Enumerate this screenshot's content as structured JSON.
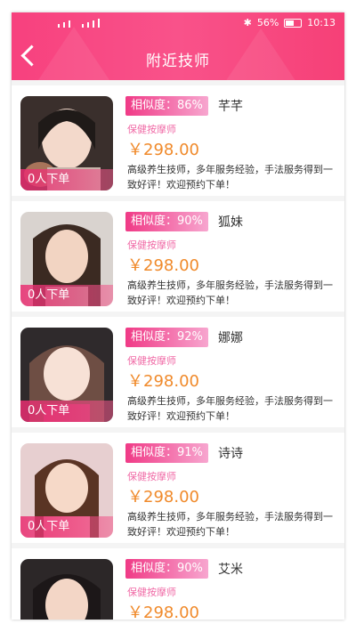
{
  "status_bar": {
    "battery_percent": "56%",
    "time": "10:13"
  },
  "header": {
    "title": "附近技师"
  },
  "technicians": [
    {
      "similarity": "相似度：86%",
      "name": "芊芊",
      "role": "保健按摩师",
      "price": "￥298.00",
      "desc": "高级养生技师，多年服务经验，手法服务得到一致好评！欢迎预约下单！",
      "orders": "0人下单"
    },
    {
      "similarity": "相似度：90%",
      "name": "狐妹",
      "role": "保健按摩师",
      "price": "￥298.00",
      "desc": "高级养生技师，多年服务经验，手法服务得到一致好评！欢迎预约下单！",
      "orders": "0人下单"
    },
    {
      "similarity": "相似度：92%",
      "name": "娜娜",
      "role": "保健按摩师",
      "price": "￥298.00",
      "desc": "高级养生技师，多年服务经验，手法服务得到一致好评！欢迎预约下单！",
      "orders": "0人下单"
    },
    {
      "similarity": "相似度：91%",
      "name": "诗诗",
      "role": "保健按摩师",
      "price": "￥298.00",
      "desc": "高级养生技师，多年服务经验，手法服务得到一致好评！欢迎预约下单！",
      "orders": "0人下单"
    },
    {
      "similarity": "相似度：90%",
      "name": "艾米",
      "role": "保健按摩师",
      "price": "￥298.00",
      "desc": "",
      "orders": ""
    }
  ]
}
